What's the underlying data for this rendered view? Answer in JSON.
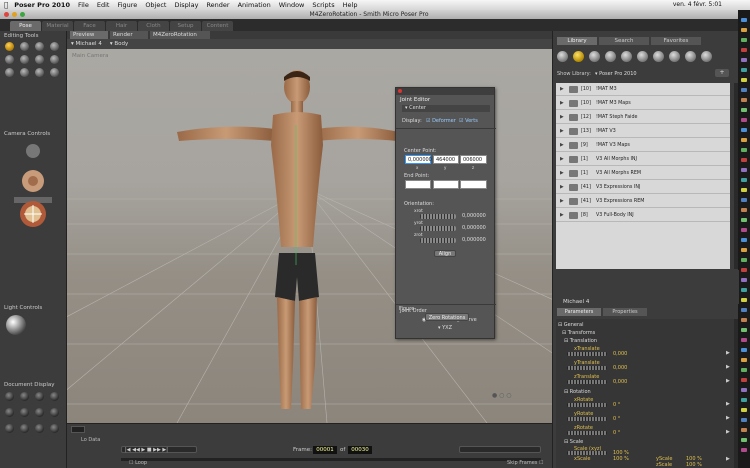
{
  "menubar": {
    "app": "Poser Pro 2010",
    "items": [
      "File",
      "Edit",
      "Figure",
      "Object",
      "Display",
      "Render",
      "Animation",
      "Window",
      "Scripts",
      "Help"
    ],
    "clock": "ven. 4 févr.  5:01"
  },
  "window": {
    "title": "M4ZeroRotation - Smith Micro Poser Pro"
  },
  "rooms": {
    "tabs": [
      "Pose",
      "Material",
      "Face",
      "Hair",
      "Cloth",
      "Setup",
      "Content"
    ]
  },
  "left_panel": {
    "editing_tools_title": "Editing Tools",
    "camera_controls_title": "Camera Controls",
    "light_controls_title": "Light Controls",
    "document_display_title": "Document Display"
  },
  "viewport": {
    "tabs": [
      "Preview",
      "Render",
      "M4ZeroRotation"
    ],
    "figure_select": "Michael 4",
    "actor_select": "Body",
    "camera_label": "Main Camera"
  },
  "joint_editor": {
    "title": "Joint Editor",
    "section": "Center",
    "display_label": "Display:",
    "deformer_label": "Deformer",
    "verts_label": "Verts",
    "center_point_label": "Center Point:",
    "center_point": [
      "0,000000",
      "464000",
      "006000"
    ],
    "axis_labels": [
      "x",
      "y",
      "z"
    ],
    "end_point_label": "End Point:",
    "end_point": [
      "",
      "",
      ""
    ],
    "orientation_label": "Orientation:",
    "orient_rows": [
      {
        "label": "xrot",
        "value": "0,000000"
      },
      {
        "label": "yrot",
        "value": "0,000000"
      },
      {
        "label": "zrot",
        "value": "0,000000"
      }
    ],
    "align_button": "Align",
    "joint_order_label": "Joint Order",
    "standard_label": "Standard",
    "curve_label": "Curve",
    "order_value": "YXZ",
    "figure_label": "Figure",
    "zero_rotations_button": "Zero Rotations"
  },
  "timeline": {
    "frame_label": "Frame:",
    "frame_value": "00001",
    "of_label": "of",
    "total_frames": "00030",
    "loop_label": "Loop",
    "skip_frames_label": "Skip Frames",
    "lo_data_label": "Lo Data"
  },
  "library": {
    "tabs": [
      "Library",
      "Search",
      "Favorites"
    ],
    "show_library_label": "Show Library:",
    "library_name": "Poser Pro 2010",
    "items": [
      {
        "count": "[10]",
        "name": "!MAT M3"
      },
      {
        "count": "[10]",
        "name": "!MAT M3 Maps"
      },
      {
        "count": "[12]",
        "name": "!MAT Steph Faide"
      },
      {
        "count": "[13]",
        "name": "!MAT V3"
      },
      {
        "count": "[9]",
        "name": "!MAT V3 Maps"
      },
      {
        "count": "[1]",
        "name": "V3 All Morphs INJ"
      },
      {
        "count": "[1]",
        "name": "V3 All Morphs REM"
      },
      {
        "count": "[41]",
        "name": "V3 Expressions INJ"
      },
      {
        "count": "[41]",
        "name": "V3 Expressions REM"
      },
      {
        "count": "[8]",
        "name": "V3 Full-Body INJ"
      }
    ]
  },
  "parameters": {
    "figure_name": "Michael 4",
    "tabs": [
      "Parameters",
      "Properties"
    ],
    "general_label": "General",
    "transforms_label": "Transforms",
    "translation_label": "Translation",
    "translation": [
      {
        "label": "xTranslate",
        "value": "0,000"
      },
      {
        "label": "yTranslate",
        "value": "0,000"
      },
      {
        "label": "zTranslate",
        "value": "0,000"
      }
    ],
    "rotation_label": "Rotation",
    "rotation": [
      {
        "label": "xRotate",
        "value": "0 °"
      },
      {
        "label": "yRotate",
        "value": "0 °"
      },
      {
        "label": "zRotate",
        "value": "0 °"
      }
    ],
    "scale_label": "Scale",
    "scale": [
      {
        "label": "Scale (xyz)",
        "value": "100 %"
      },
      {
        "label": "xScale",
        "value": "100 %"
      },
      {
        "label": "yScale",
        "value": "100 %"
      },
      {
        "label": "zScale",
        "value": "100 %"
      }
    ]
  },
  "colors": {
    "accent": "#f0b020",
    "panel": "#3c3c3c",
    "viewport": "#a9a6a0"
  }
}
